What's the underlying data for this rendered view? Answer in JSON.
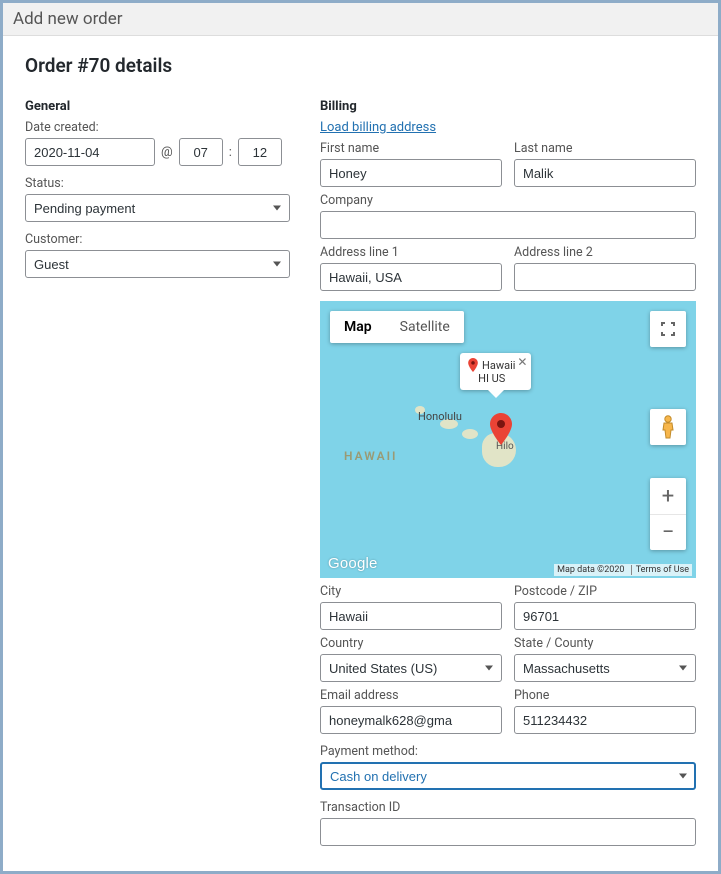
{
  "titlebar": "Add new order",
  "page_title": "Order #70 details",
  "general": {
    "heading": "General",
    "date_label": "Date created:",
    "date_value": "2020-11-04",
    "at": "@",
    "hour": "07",
    "colon": ":",
    "minute": "12",
    "status_label": "Status:",
    "status_value": "Pending payment",
    "customer_label": "Customer:",
    "customer_value": "Guest"
  },
  "billing": {
    "heading": "Billing",
    "load_link": "Load billing address",
    "first_name_label": "First name",
    "first_name": "Honey",
    "last_name_label": "Last name",
    "last_name": "Malik",
    "company_label": "Company",
    "company": "",
    "addr1_label": "Address line 1",
    "addr1": "Hawaii, USA",
    "addr2_label": "Address line 2",
    "addr2": "",
    "city_label": "City",
    "city": "Hawaii",
    "postcode_label": "Postcode / ZIP",
    "postcode": "96701",
    "country_label": "Country",
    "country": "United States (US)",
    "state_label": "State / County",
    "state": "Massachusetts",
    "email_label": "Email address",
    "email": "honeymalk628@gma",
    "phone_label": "Phone",
    "phone": "511234432",
    "payment_label": "Payment method:",
    "payment": "Cash on delivery",
    "txn_label": "Transaction ID",
    "txn": ""
  },
  "map": {
    "tab_map": "Map",
    "tab_satellite": "Satellite",
    "region_label": "HAWAII",
    "city1": "Honolulu",
    "city2": "Hilo",
    "info_title": "Hawaii",
    "info_sub": "HI US",
    "google": "Google",
    "footer_data": "Map data ©2020",
    "footer_terms": "Terms of Use"
  }
}
